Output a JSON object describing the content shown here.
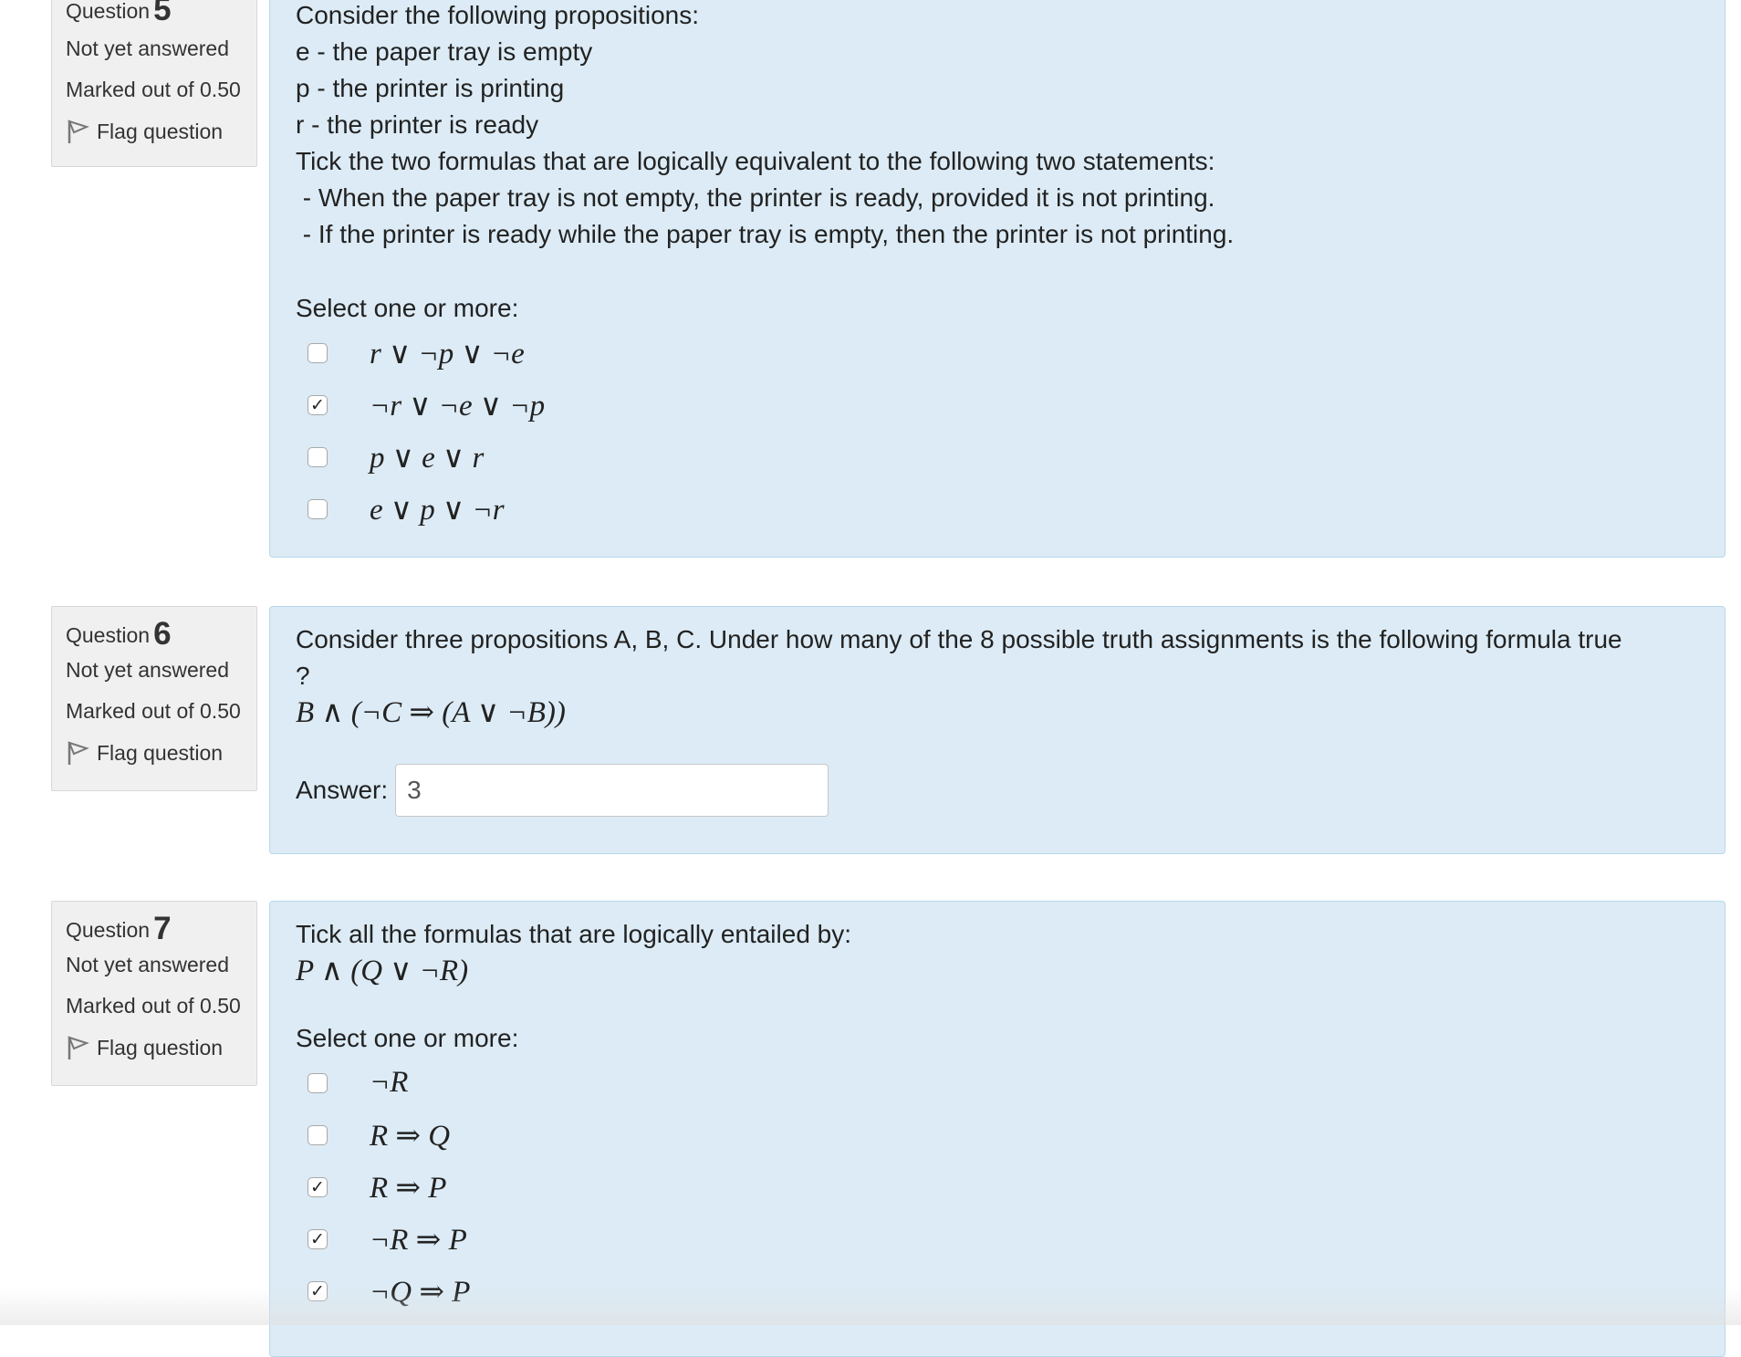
{
  "questions": [
    {
      "label": "Question",
      "number": "5",
      "state": "Not yet answered",
      "grade": "Marked out of 0.50",
      "flag_label": "Flag question",
      "text_lines": [
        "Consider the following propositions:",
        "e - the paper tray is empty",
        "p - the printer is printing",
        "r - the printer is ready",
        "Tick the two formulas that are logically equivalent to the following two statements:",
        " - When the paper tray is not empty, the printer is ready, provided it is not printing.",
        " - If the printer is ready while the paper tray is empty, then the printer is not printing."
      ],
      "prompt": "Select one or more:",
      "options": [
        {
          "formula": "r ∨ ¬p ∨ ¬e",
          "checked": false
        },
        {
          "formula": "¬r ∨ ¬e ∨ ¬p",
          "checked": true
        },
        {
          "formula": "p ∨ e ∨ r",
          "checked": false
        },
        {
          "formula": "e ∨ p ∨ ¬r",
          "checked": false
        }
      ]
    },
    {
      "label": "Question",
      "number": "6",
      "state": "Not yet answered",
      "grade": "Marked out of 0.50",
      "flag_label": "Flag question",
      "text_lines": [
        "Consider three propositions A, B, C. Under how many of the 8 possible truth assignments is the following formula true",
        "?"
      ],
      "formula": "B ∧ (¬C ⇒ (A ∨ ¬B))",
      "answer_label": "Answer:",
      "answer_value": "3"
    },
    {
      "label": "Question",
      "number": "7",
      "state": "Not yet answered",
      "grade": "Marked out of 0.50",
      "flag_label": "Flag question",
      "text_lines": [
        "Tick all the formulas that are logically entailed by:"
      ],
      "formula": "P ∧ (Q ∨ ¬R)",
      "prompt": "Select one or more:",
      "options": [
        {
          "formula": "¬R",
          "checked": false
        },
        {
          "formula": "R ⇒ Q",
          "checked": false
        },
        {
          "formula": "R ⇒ P",
          "checked": true
        },
        {
          "formula": "¬R ⇒ P",
          "checked": true
        },
        {
          "formula": "¬Q ⇒ P",
          "checked": true
        }
      ]
    }
  ],
  "colors": {
    "content_bg": "#dcebf5",
    "content_border": "#b8d8ec",
    "info_bg": "#f0f0f0"
  },
  "icons": {
    "flag": "flag-icon",
    "check": "check-icon"
  }
}
